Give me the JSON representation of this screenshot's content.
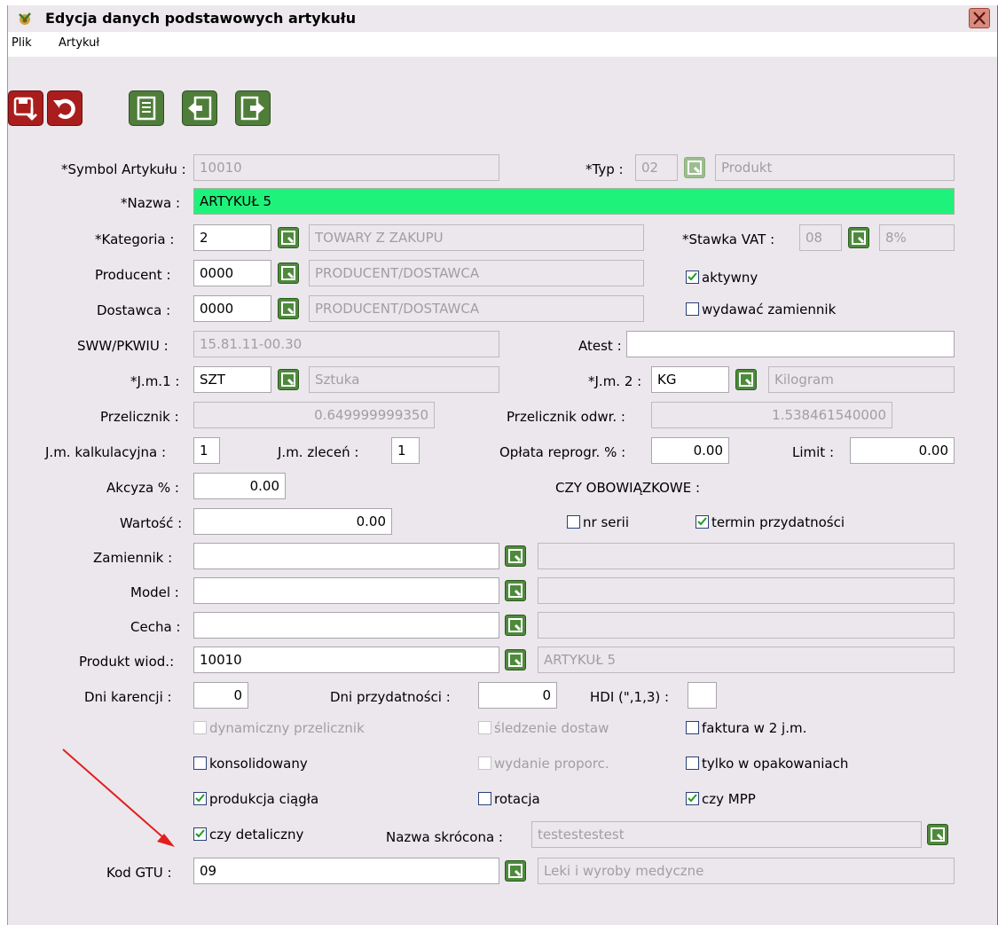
{
  "window": {
    "title": "Edycja danych podstawowych artykułu"
  },
  "menu": [
    "Plik",
    "Artykuł"
  ],
  "toolbar": [
    {
      "name": "save-button",
      "icon": "save-icon",
      "color": "#aa1d1d"
    },
    {
      "name": "undo-button",
      "icon": "undo-icon",
      "color": "#aa1d1d"
    },
    {
      "name": "document-button",
      "icon": "document-icon",
      "color": "#4f7d3a"
    },
    {
      "name": "prev-button",
      "icon": "arrow-left-icon",
      "color": "#4f7d3a"
    },
    {
      "name": "next-button",
      "icon": "arrow-right-icon",
      "color": "#4f7d3a"
    }
  ],
  "labels": {
    "symbol": "*Symbol Artykułu :",
    "typ": "*Typ :",
    "nazwa": "*Nazwa :",
    "kategoria": "*Kategoria :",
    "stawka": "*Stawka VAT :",
    "producent": "Producent :",
    "dostawca": "Dostawca :",
    "sww": "SWW/PKWIU :",
    "atest": "Atest :",
    "jm1": "*J.m.1 :",
    "jm2": "*J.m. 2 :",
    "przelicznik": "Przelicznik :",
    "przelicznik_odwr": "Przelicznik odwr. :",
    "jm_kalk": "J.m. kalkulacyjna :",
    "jm_zlecen": "J.m. zleceń :",
    "oplata": "Opłata reprogr. % :",
    "limit": "Limit :",
    "akcyza": "Akcyza % :",
    "czy_obowiazkowe": "CZY OBOWIĄZKOWE :",
    "wartosc": "Wartość :",
    "zamiennik": "Zamiennik :",
    "model": "Model :",
    "cecha": "Cecha :",
    "produkt_wiod": "Produkt wiod.:",
    "dni_karencji": "Dni karencji :",
    "dni_przydatnosci": "Dni przydatności :",
    "hdi": "HDI (\",1,3) :",
    "nazwa_skrocona": "Nazwa skrócona :",
    "kod_gtu": "Kod GTU :"
  },
  "values": {
    "symbol": "10010",
    "typ_code": "02",
    "typ_name": "Produkt",
    "nazwa": "ARTYKUŁ 5",
    "kategoria_code": "2",
    "kategoria_name": "TOWARY Z ZAKUPU",
    "stawka_code": "08",
    "stawka_name": "8%",
    "producent_code": "0000",
    "producent_name": "PRODUCENT/DOSTAWCA",
    "dostawca_code": "0000",
    "dostawca_name": "PRODUCENT/DOSTAWCA",
    "sww": "15.81.11-00.30",
    "atest": "",
    "jm1_code": "SZT",
    "jm1_name": "Sztuka",
    "jm2_code": "KG",
    "jm2_name": "Kilogram",
    "przelicznik": "0.649999999350",
    "przelicznik_odwr": "1.538461540000",
    "jm_kalk": "1",
    "jm_zlecen": "1",
    "oplata": "0.00",
    "limit": "0.00",
    "akcyza": "0.00",
    "wartosc": "0.00",
    "zamiennik_code": "",
    "zamiennik_name": "",
    "model_code": "",
    "model_name": "",
    "cecha_code": "",
    "cecha_name": "",
    "produkt_wiod_code": "10010",
    "produkt_wiod_name": "ARTYKUŁ 5",
    "dni_karencji": "0",
    "dni_przydatnosci": "0",
    "hdi": "",
    "nazwa_skrocona": "testestestest",
    "kod_gtu_code": "09",
    "kod_gtu_name": "Leki i wyroby medyczne"
  },
  "checkboxes": {
    "aktywny": {
      "label": "aktywny",
      "checked": true,
      "enabled": true
    },
    "wydawac_zamiennik": {
      "label": "wydawać zamiennik",
      "checked": false,
      "enabled": true
    },
    "nr_serii": {
      "label": "nr serii",
      "checked": false,
      "enabled": true
    },
    "termin_przydatnosci": {
      "label": "termin przydatności",
      "checked": true,
      "enabled": true
    },
    "dynamiczny_przelicznik": {
      "label": "dynamiczny przelicznik",
      "checked": false,
      "enabled": false
    },
    "sledzenie_dostaw": {
      "label": "śledzenie dostaw",
      "checked": false,
      "enabled": false
    },
    "faktura_2jm": {
      "label": "faktura w 2 j.m.",
      "checked": false,
      "enabled": true
    },
    "konsolidowany": {
      "label": "konsolidowany",
      "checked": false,
      "enabled": true
    },
    "wydanie_proporc": {
      "label": "wydanie proporc.",
      "checked": false,
      "enabled": false
    },
    "tylko_w_opakowaniach": {
      "label": "tylko w opakowaniach",
      "checked": false,
      "enabled": true
    },
    "produkcja_ciagla": {
      "label": "produkcja ciągła",
      "checked": true,
      "enabled": true
    },
    "rotacja": {
      "label": "rotacja",
      "checked": false,
      "enabled": true
    },
    "czy_mpp": {
      "label": "czy MPP",
      "checked": true,
      "enabled": true
    },
    "czy_detaliczny": {
      "label": "czy detaliczny",
      "checked": true,
      "enabled": true
    }
  },
  "colors": {
    "background": "#ece7ed",
    "highlight_field": "#1ff27a",
    "lookup_button": "#4e8a3c",
    "annotation_arrow": "#e02020"
  }
}
